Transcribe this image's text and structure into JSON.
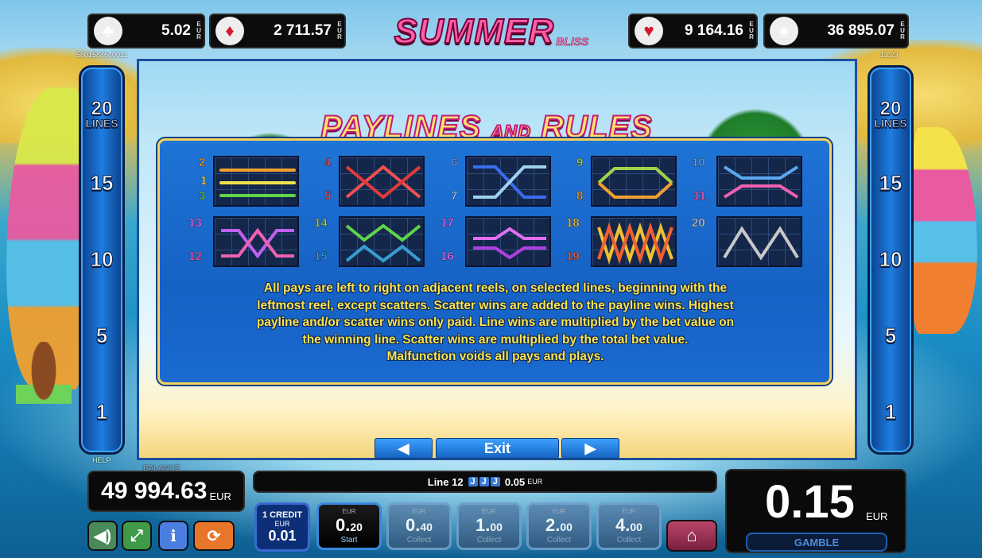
{
  "title": {
    "main": "SUMMER",
    "sub": "BLISS"
  },
  "jackpots": [
    {
      "suit_icon": "club-icon",
      "symbol": "♣",
      "value": "5.02",
      "currency": "E\nU\nR"
    },
    {
      "suit_icon": "diamond-icon",
      "symbol": "♦",
      "value": "2 711.57",
      "currency": "E\nU\nR"
    },
    {
      "suit_icon": "heart-icon",
      "symbol": "♥",
      "value": "9 164.16",
      "currency": "E\nU\nR"
    },
    {
      "suit_icon": "spade-icon",
      "symbol": "♠",
      "value": "36 895.07",
      "currency": "E\nU\nR"
    }
  ],
  "session_id": "5801584640011",
  "clock": "13:23",
  "lines_column": {
    "top_value": "20",
    "top_label": "LINES",
    "values": [
      "15",
      "10",
      "5",
      "1"
    ]
  },
  "help_label": "HELP",
  "heading": {
    "part1": "PAYLINES",
    "and": "AND",
    "part2": "RULES"
  },
  "paylines": [
    {
      "labels": [
        "2",
        "1",
        "3"
      ],
      "colors": [
        "#f0a030",
        "#f3e24a",
        "#5fd34a"
      ]
    },
    {
      "labels": [
        "4",
        "5"
      ],
      "colors": [
        "#f05050",
        "#e03a3a"
      ]
    },
    {
      "labels": [
        "6",
        "7"
      ],
      "colors": [
        "#3a6cf0",
        "#9fd0f0"
      ]
    },
    {
      "labels": [
        "9",
        "8"
      ],
      "colors": [
        "#9fd34a",
        "#f0a030"
      ]
    },
    {
      "labels": [
        "10",
        "11"
      ],
      "colors": [
        "#5aa8f0",
        "#f060b0"
      ]
    },
    {
      "labels": [
        "13",
        "12"
      ],
      "colors": [
        "#c060f0",
        "#f060b0"
      ]
    },
    {
      "labels": [
        "14",
        "15"
      ],
      "colors": [
        "#5fd34a",
        "#3a9cd0"
      ]
    },
    {
      "labels": [
        "17",
        "16"
      ],
      "colors": [
        "#e070f0",
        "#b040e0"
      ]
    },
    {
      "labels": [
        "18",
        "19"
      ],
      "colors": [
        "#f0c030",
        "#f06030"
      ]
    },
    {
      "labels": [
        "20"
      ],
      "colors": [
        "#c8c8c8"
      ]
    }
  ],
  "rules_text": [
    "All pays are left to right on adjacent reels, on selected lines, beginning with the",
    "leftmost reel, except scatters. Scatter wins are added to the payline wins. Highest",
    "payline and/or scatter wins only paid. Line wins are multiplied by the bet value on",
    "the winning line. Scatter wins are multiplied by the total bet value.",
    "Malfunction voids all pays and plays."
  ],
  "nav": {
    "prev": "◀",
    "exit": "Exit",
    "next": "▶"
  },
  "balance": {
    "label": "BALANCE",
    "value": "49 994.63",
    "currency": "EUR"
  },
  "line_info": {
    "text": "Line 12",
    "symbols": [
      "J",
      "J",
      "J"
    ],
    "amount": "0.05",
    "currency": "EUR"
  },
  "credit": {
    "label": "1 CREDIT",
    "currency": "EUR",
    "value": "0.01"
  },
  "bets": [
    {
      "currency": "EUR",
      "int": "0.",
      "dec": "20",
      "action": "Start",
      "active": true
    },
    {
      "currency": "EUR",
      "int": "0.",
      "dec": "40",
      "action": "Collect",
      "active": false
    },
    {
      "currency": "EUR",
      "int": "1.",
      "dec": "00",
      "action": "Collect",
      "active": false
    },
    {
      "currency": "EUR",
      "int": "2.",
      "dec": "00",
      "action": "Collect",
      "active": false
    },
    {
      "currency": "EUR",
      "int": "4.",
      "dec": "00",
      "action": "Collect",
      "active": false
    }
  ],
  "total_bet": {
    "value": "0.15",
    "currency": "EUR"
  },
  "gamble_label": "GAMBLE",
  "icons": {
    "sound": "speaker-icon",
    "fullscreen": "fullscreen-icon",
    "info": "info-icon",
    "autoplay": "autoplay-icon",
    "home": "home-icon"
  }
}
